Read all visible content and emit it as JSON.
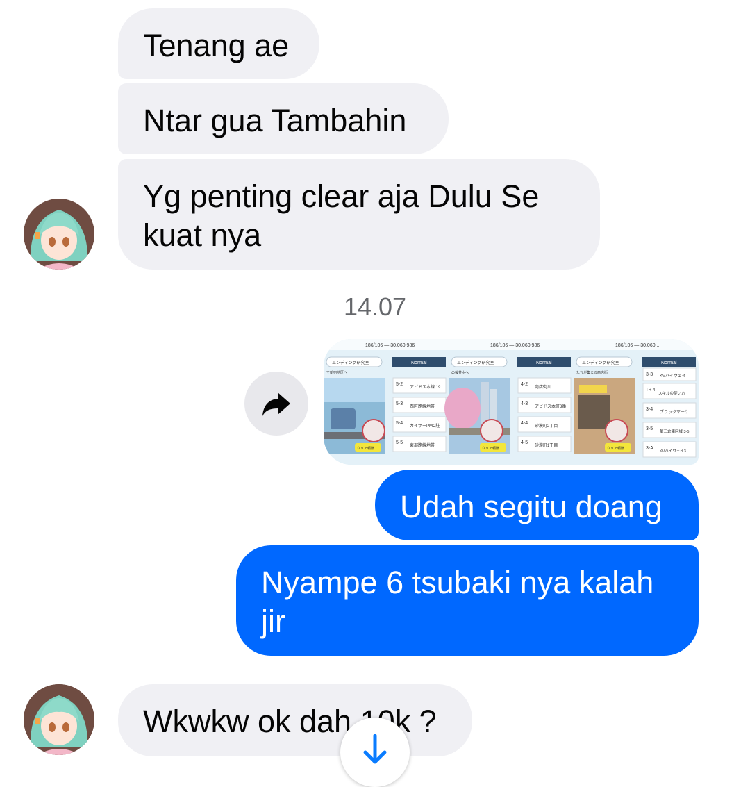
{
  "messages": {
    "m1": "Tenang ae",
    "m2": "Ntar gua Tambahin",
    "m3_line1": "Yg penting clear aja Dulu Se",
    "m3_line2": "kuat nya",
    "timestamp": "14.07",
    "o1": "Udah segitu doang",
    "o2_line1": "Nyampe 6 tsubaki nya kalah",
    "o2_line2": "jir",
    "m4": "Wkwkw ok dah 10k ?"
  },
  "screenshot_panels": [
    {
      "topbar": "186/106 — 30.060.986",
      "tab": "Normal",
      "header": "エンディング研究室",
      "subtitle": "で新宿地区へ",
      "clear_label": "クリア報酬",
      "levels": [
        {
          "code": "5-2",
          "name": "アビドス本線 19"
        },
        {
          "code": "5-3",
          "name": "西区路線地帯"
        },
        {
          "code": "5-4",
          "name": "カイザーPMC駐"
        },
        {
          "code": "5-5",
          "name": "東部路線地帯"
        }
      ]
    },
    {
      "topbar": "186/106 — 30.060.986",
      "tab": "Normal",
      "header": "エンディング研究室",
      "subtitle": "の桜並木へ",
      "clear_label": "クリア報酬",
      "levels": [
        {
          "code": "4-2",
          "name": "商店街川"
        },
        {
          "code": "4-3",
          "name": "アビドス本町3番"
        },
        {
          "code": "4-4",
          "name": "砂漠町2丁目"
        },
        {
          "code": "4-5",
          "name": "砂漠町1丁目"
        }
      ]
    },
    {
      "topbar": "186/106 — 30.060...",
      "tab": "Normal",
      "header": "エンディング研究室",
      "subtitle": "たちが集まる商店街",
      "clear_label": "クリア報酬",
      "levels": [
        {
          "code": "3-3",
          "name": "KVハイウェイ"
        },
        {
          "code": "TR-4",
          "name": "スキルの使い方"
        },
        {
          "code": "3-4",
          "name": "ブラックマーケ"
        },
        {
          "code": "3-5",
          "name": "第三倉庫区域 3-5"
        },
        {
          "code": "3-A",
          "name": "KVハイウェイ3"
        }
      ]
    }
  ],
  "colors": {
    "incoming_bubble": "#f0f0f4",
    "outgoing_bubble": "#0068ff",
    "accent": "#0a7cff"
  },
  "icons": {
    "share": "share-arrow-icon",
    "scroll": "arrow-down-icon"
  }
}
